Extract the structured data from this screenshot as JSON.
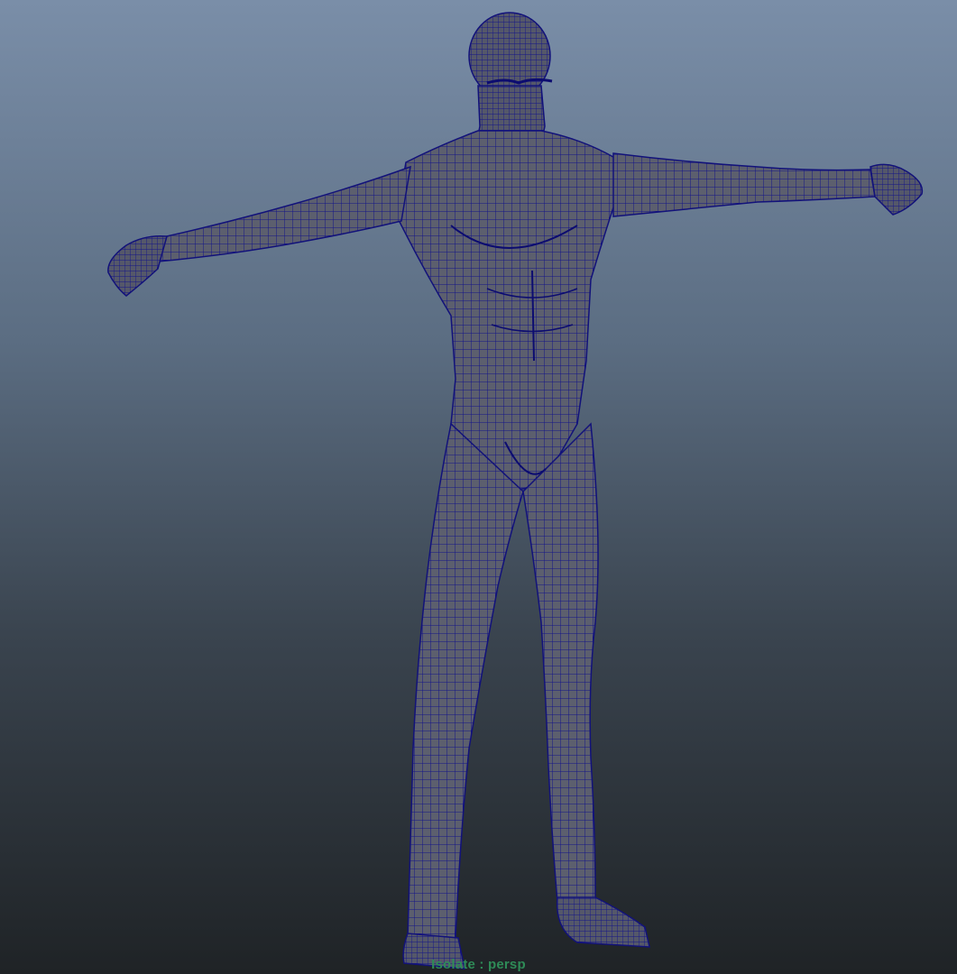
{
  "viewport": {
    "camera": "persp",
    "isolate_label": "Isolate : persp",
    "background_top": "#7a8ea8",
    "background_bottom": "#1f2326"
  },
  "model": {
    "display_mode": "wireframe-on-shaded",
    "shade_color": "#5c5f6e",
    "wire_color": "#141488"
  },
  "colors": {
    "hud_text": "#2e8b57"
  }
}
